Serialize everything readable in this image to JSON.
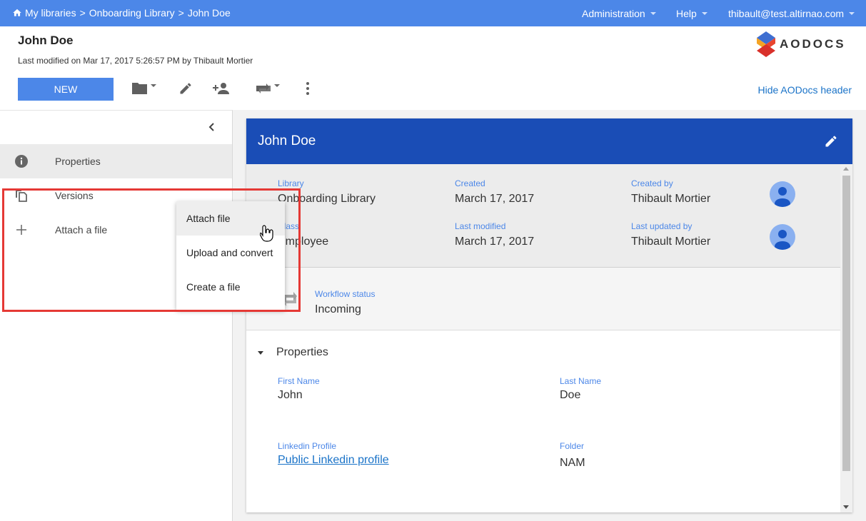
{
  "topbar": {
    "breadcrumb": [
      "My libraries",
      "Onboarding Library",
      "John Doe"
    ],
    "administration_label": "Administration",
    "help_label": "Help",
    "user_label": "thibault@test.altirnao.com",
    "bg_color": "#4c87e8"
  },
  "header": {
    "title": "John Doe",
    "subtitle": "Last modified on Mar 17, 2017 5:26:57 PM by Thibault Mortier",
    "logo_text": "AODOCS",
    "new_button": "NEW",
    "hide_header_link": "Hide AODocs header",
    "toolbar_icons": [
      "folder-icon",
      "pencil-icon",
      "add-person-icon",
      "workflow-icon",
      "more-vert-icon"
    ]
  },
  "sidebar": {
    "items": [
      {
        "label": "Properties",
        "icon": "info-icon",
        "active": true
      },
      {
        "label": "Versions",
        "icon": "copy-icon",
        "active": false
      },
      {
        "label": "Attach a file",
        "icon": "plus-icon",
        "active": false
      }
    ]
  },
  "attach_menu": {
    "options": [
      "Attach file",
      "Upload and convert",
      "Create a file"
    ],
    "hovered": "Attach file"
  },
  "document": {
    "title": "John Doe",
    "header_color": "#1a4db6",
    "library_label": "Library",
    "library_value": "Onboarding Library",
    "created_label": "Created",
    "created_value": "March 17, 2017",
    "created_by_label": "Created by",
    "created_by_value": "Thibault Mortier",
    "class_label": "Class",
    "class_value": "Employee",
    "last_modified_label": "Last modified",
    "last_modified_value": "March 17, 2017",
    "last_updated_by_label": "Last updated by",
    "last_updated_by_value": "Thibault Mortier",
    "workflow_label": "Workflow status",
    "workflow_value": "Incoming",
    "properties_section": "Properties",
    "first_name_label": "First Name",
    "first_name_value": "John",
    "last_name_label": "Last Name",
    "last_name_value": "Doe",
    "linkedin_label": "Linkedin Profile",
    "linkedin_value": "Public Linkedin profile",
    "folder_label": "Folder",
    "folder_value": "NAM"
  }
}
